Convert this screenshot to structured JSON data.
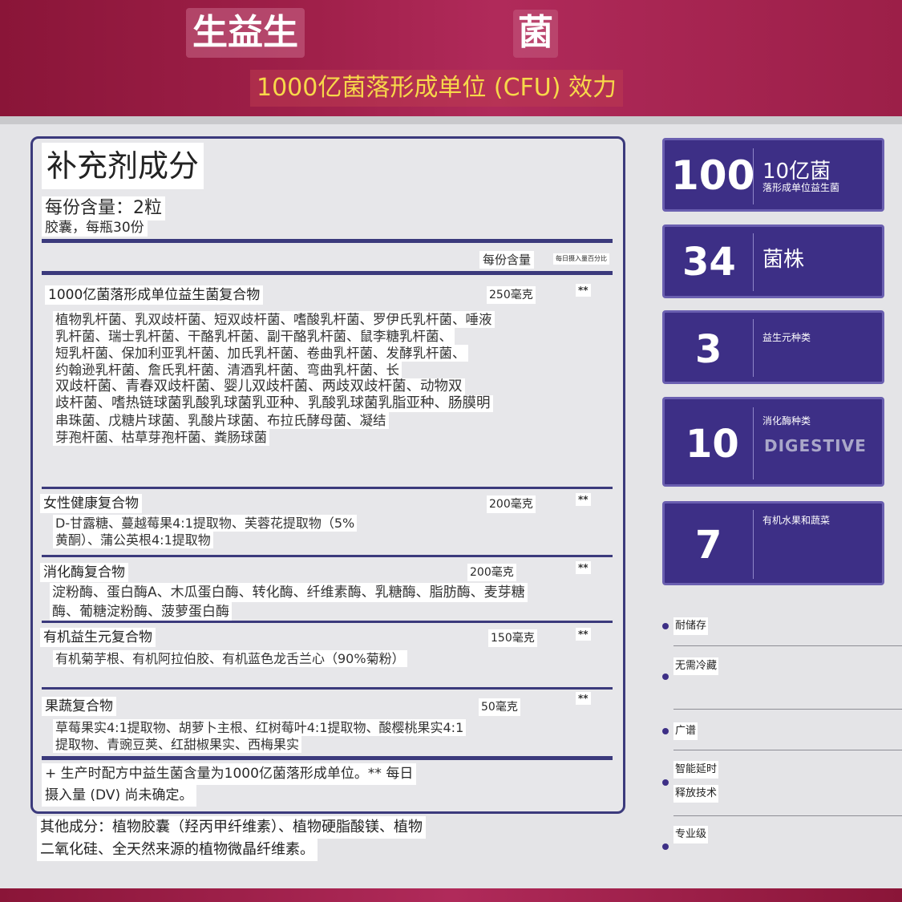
{
  "header": {
    "title_left": "生益生",
    "title_right": "菌",
    "subtitle": "1000亿菌落形成单位 (CFU) 效力",
    "colors": {
      "banner": "#9c1f48",
      "subtitle_text": "#f7d84a"
    }
  },
  "facts": {
    "title": "补充剂成分",
    "serving_size": "每份含量：2粒",
    "servings_per_container": "胶囊，每瓶30份",
    "column_amount": "每份含量",
    "column_dv": "每日摄入量百分比",
    "sections": [
      {
        "name": "1000亿菌落形成单位益生菌复合物",
        "amount": "250毫克",
        "dv": "**",
        "lines": [
          "植物乳杆菌、乳双歧杆菌、短双歧杆菌、嗜酸乳杆菌、罗伊氏乳杆菌、唾液",
          "乳杆菌、瑞士乳杆菌、干酪乳杆菌、副干酪乳杆菌、鼠李糖乳杆菌、",
          "短乳杆菌、保加利亚乳杆菌、加氏乳杆菌、卷曲乳杆菌、发酵乳杆菌、",
          "约翰逊乳杆菌、詹氏乳杆菌、清酒乳杆菌、弯曲乳杆菌、长",
          "双歧杆菌、青春双歧杆菌、婴儿双歧杆菌、两歧双歧杆菌、动物双",
          "歧杆菌、嗜热链球菌乳酸乳球菌乳亚种、乳酸乳球菌乳脂亚种、肠膜明",
          "串珠菌、戊糖片球菌、乳酸片球菌、布拉氏酵母菌、凝结",
          "芽孢杆菌、枯草芽孢杆菌、粪肠球菌"
        ]
      },
      {
        "name": "女性健康复合物",
        "amount": "200毫克",
        "dv": "**",
        "lines": [
          "D-甘露糖、蔓越莓果4:1提取物、芙蓉花提取物（5%",
          "黄酮）、蒲公英根4:1提取物"
        ]
      },
      {
        "name": "消化酶复合物",
        "amount": "200毫克",
        "dv": "**",
        "lines": [
          "淀粉酶、蛋白酶A、木瓜蛋白酶、转化酶、纤维素酶、乳糖酶、脂肪酶、麦芽糖",
          "酶、葡糖淀粉酶、菠萝蛋白酶"
        ]
      },
      {
        "name": "有机益生元复合物",
        "amount": "150毫克",
        "dv": "**",
        "lines": [
          "有机菊芋根、有机阿拉伯胶、有机蓝色龙舌兰心（90%菊粉）"
        ]
      },
      {
        "name": "果蔬复合物",
        "amount": "50毫克",
        "dv": "**",
        "lines": [
          "草莓果实4:1提取物、胡萝卜主根、红树莓叶4:1提取物、酸樱桃果实4:1",
          "提取物、青豌豆荚、红甜椒果实、西梅果实"
        ]
      }
    ],
    "footnote": [
      "+ 生产时配方中益生菌含量为1000亿菌落形成单位。** 每日",
      "摄入量 (DV) 尚未确定。"
    ],
    "other_ingredients": [
      "其他成分：植物胶囊（羟丙甲纤维素）、植物硬脂酸镁、植物",
      "二氧化硅、全天然来源的植物微晶纤维素。"
    ]
  },
  "cards": [
    {
      "number": "100",
      "label": "10亿菌",
      "sub": "落形成单位益生菌"
    },
    {
      "number": "34",
      "label": "菌株",
      "sub": ""
    },
    {
      "number": "3",
      "label": "",
      "sub": "益生元种类"
    },
    {
      "number": "10",
      "label": "",
      "sub": "消化酶种类",
      "faded": "DIGESTIVE"
    },
    {
      "number": "7",
      "label": "",
      "sub": "有机水果和蔬菜"
    }
  ],
  "features": [
    {
      "label": "耐储存"
    },
    {
      "label": "无需冷藏"
    },
    {
      "label": "广谱"
    },
    {
      "label_line1": "智能延时",
      "label_line2": "释放技术"
    },
    {
      "label": "专业级"
    }
  ],
  "colors": {
    "panel_border": "#3b3a7c",
    "card_bg": "#3d2f86"
  }
}
